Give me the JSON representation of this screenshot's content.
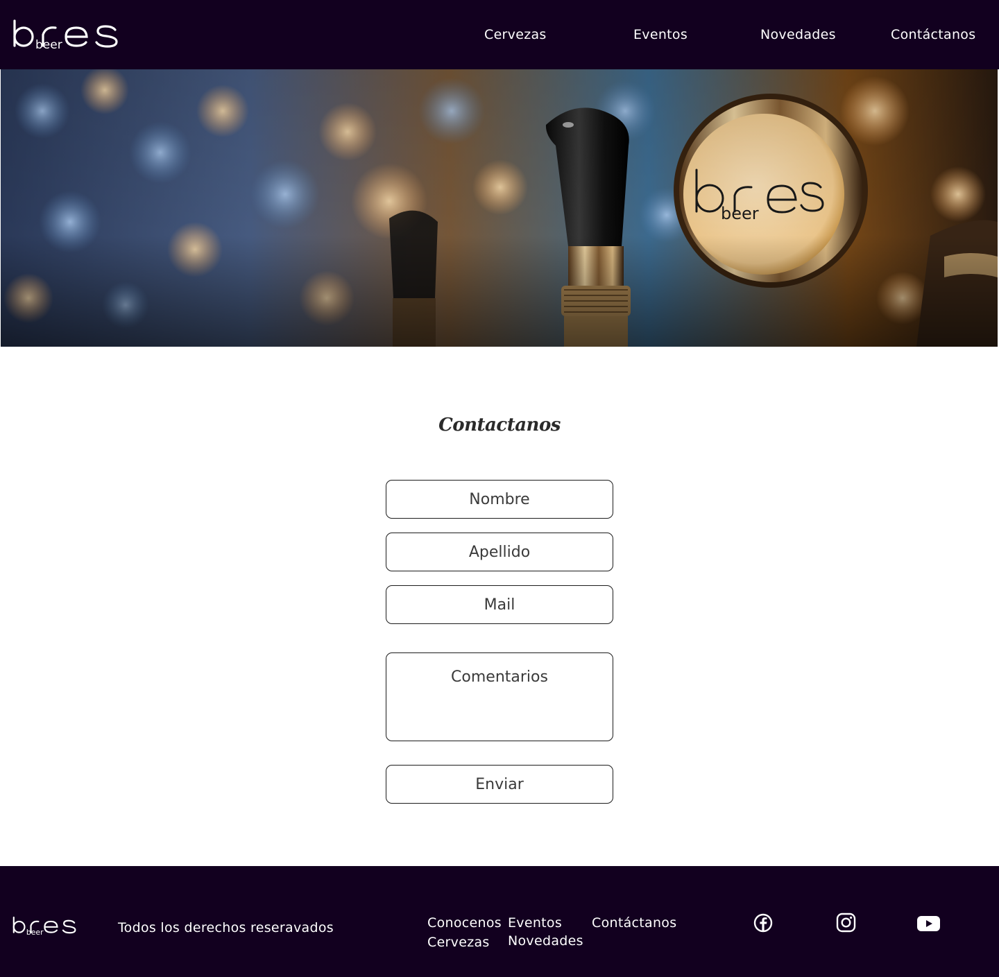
{
  "brand": {
    "logo_main": "bres",
    "logo_sub": "beer"
  },
  "nav": {
    "items": [
      {
        "label": "Cervezas"
      },
      {
        "label": "Eventos"
      },
      {
        "label": "Novedades"
      },
      {
        "label": "Contáctanos"
      }
    ]
  },
  "hero": {
    "image": "photo-of-beer-tap-handles-with-bres-beer-badge"
  },
  "form": {
    "title": "Contactanos",
    "nombre_placeholder": "Nombre",
    "apellido_placeholder": "Apellido",
    "mail_placeholder": "Mail",
    "comentarios_placeholder": "Comentarios",
    "submit_label": "Enviar"
  },
  "footer": {
    "copyright": "Todos los derechos reseravados",
    "links": [
      {
        "label": "Conocenos"
      },
      {
        "label": "Cervezas"
      },
      {
        "label": "Eventos"
      },
      {
        "label": "Novedades"
      },
      {
        "label": "Contáctanos"
      }
    ],
    "social": [
      "facebook-icon",
      "instagram-icon",
      "youtube-icon"
    ]
  },
  "colors": {
    "header_bg": "#12001f",
    "footer_bg": "#12001f",
    "text_light": "#ffffff",
    "field_border": "#1b1b1b"
  }
}
